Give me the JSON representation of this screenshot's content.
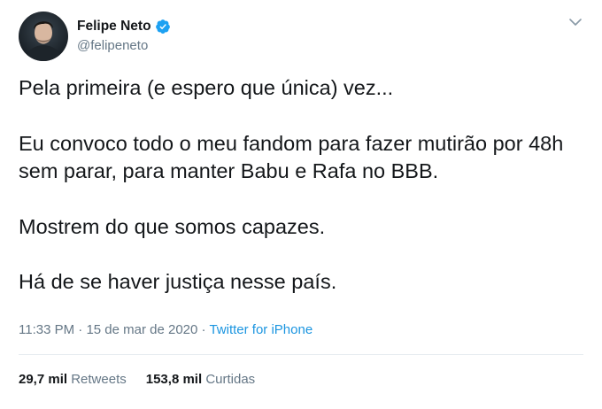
{
  "user": {
    "display_name": "Felipe Neto",
    "handle": "@felipeneto",
    "verified": true
  },
  "tweet": {
    "paragraphs": [
      "Pela primeira (e espero que única) vez...",
      "Eu convoco todo o meu fandom para fazer mutirão por 48h sem parar, para manter Babu e Rafa no BBB.",
      "Mostrem do que somos capazes.",
      "Há de se haver justiça nesse país."
    ]
  },
  "meta": {
    "time": "11:33 PM",
    "separator": "·",
    "date": "15 de mar de 2020",
    "source": "Twitter for iPhone"
  },
  "stats": {
    "retweets_count": "29,7 mil",
    "retweets_label": "Retweets",
    "likes_count": "153,8 mil",
    "likes_label": "Curtidas"
  },
  "colors": {
    "accent": "#1da1f2",
    "link": "#1b95e0",
    "muted": "#657786",
    "text": "#14171a"
  },
  "icons": {
    "verified": "verified-badge-icon",
    "menu": "chevron-down-icon"
  }
}
